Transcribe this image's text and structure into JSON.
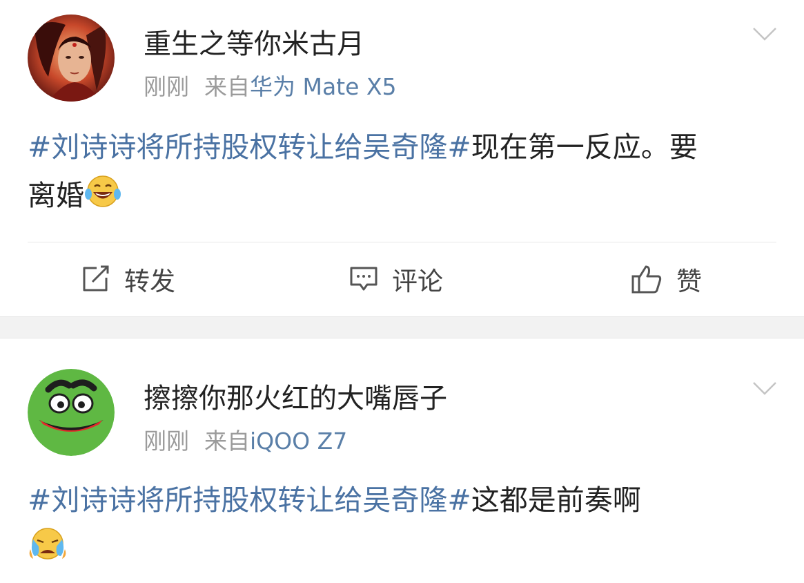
{
  "posts": [
    {
      "username": "重生之等你米古月",
      "time": "刚刚",
      "source_prefix": "来自",
      "source_device": "华为 Mate X5",
      "hashtag": "#刘诗诗将所持股权转让给吴奇隆#",
      "text": "现在第一反应。要离婚",
      "emoji": "laughing-tears-emoji"
    },
    {
      "username": "擦擦你那火红的大嘴唇子",
      "time": "刚刚",
      "source_prefix": "来自",
      "source_device": "iQOO Z7",
      "hashtag": "#刘诗诗将所持股权转让给吴奇隆#",
      "text": "这都是前奏啊",
      "emoji": "crying-emoji"
    }
  ],
  "actions": {
    "repost_label": "转发",
    "comment_label": "评论",
    "like_label": "赞"
  },
  "colors": {
    "hashtag": "#4a72a3",
    "source": "#5a7fa8",
    "meta": "#9b9b9b",
    "separator": "#f2f2f2"
  }
}
